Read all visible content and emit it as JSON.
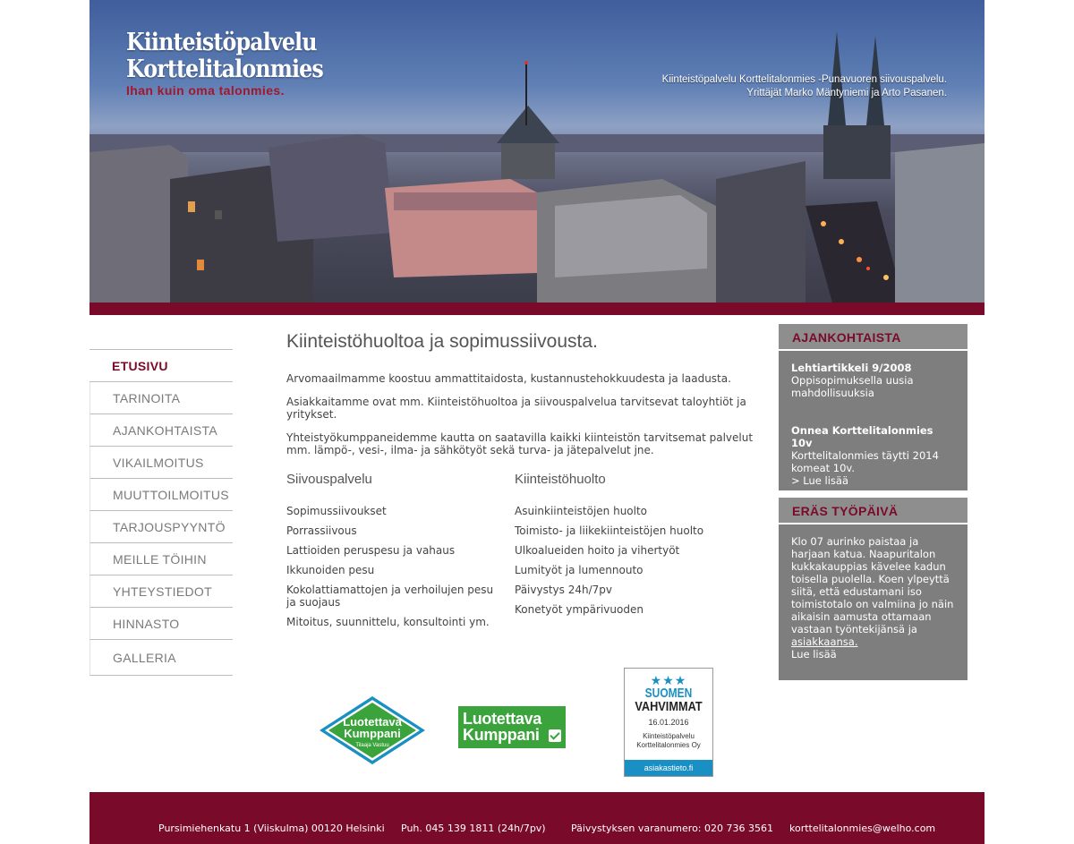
{
  "brand": {
    "line1": "Kiinteistöpalvelu",
    "line2": "Korttelitalonmies",
    "tagline": "Ihan kuin oma talonmies."
  },
  "header_info": {
    "line1": "Kiinteistöpalvelu Korttelitalonmies -Punavuoren siivouspalvelu.",
    "line2": "Yrittäjät Marko Mäntyniemi ja Arto Pasanen."
  },
  "nav": {
    "items": [
      {
        "label": "ETUSIVU",
        "active": true
      },
      {
        "label": "TARINOITA"
      },
      {
        "label": "AJANKOHTAISTA"
      },
      {
        "label": "VIKAILMOITUS"
      },
      {
        "label": "MUUTTOILMOITUS"
      },
      {
        "label": "TARJOUSPYYNTÖ"
      },
      {
        "label": "MEILLE TÖIHIN"
      },
      {
        "label": "YHTEYSTIEDOT"
      },
      {
        "label": "HINNASTO"
      },
      {
        "label": "GALLERIA"
      }
    ]
  },
  "main": {
    "title": "Kiinteistöhuoltoa ja sopimussiivousta.",
    "paragraphs": [
      "Arvomaailmamme koostuu ammattitaidosta, kustannustehokkuudesta ja laadusta.",
      "Asiakkaitamme ovat mm. Kiinteistöhuoltoa ja siivouspalvelua tarvitsevat taloyhtiöt ja yritykset.",
      "Yhteistyökumppaneidemme kautta on saatavilla kaikki kiinteistön tarvitsemat palvelut mm. lämpö-, vesi-, ilma- ja sähkötyöt sekä turva- ja jätepalvelut jne."
    ],
    "col1": {
      "heading": "Siivouspalvelu",
      "items": [
        "Sopimussiivoukset",
        "Porrassiivous",
        "Lattioiden peruspesu ja vahaus",
        "Ikkunoiden pesu",
        "Kokolattiamattojen ja verhoilujen pesu ja suojaus",
        "Mitoitus, suunnittelu, konsultointi ym."
      ]
    },
    "col2": {
      "heading": "Kiinteistöhuolto",
      "items": [
        "Asuinkiinteistöjen huolto",
        "Toimisto- ja liikekiinteistöjen huolto",
        "Ulkoalueiden hoito ja vihertyöt",
        "Lumityöt ja lumennouto",
        "Päivystys 24h/7pv",
        "Konetyöt ympärivuoden"
      ]
    }
  },
  "logos": {
    "badge1": {
      "line1": "Luotettava",
      "line2": "Kumppani",
      "line3": "Tilaaja Vastuu"
    },
    "badge2": {
      "line1": "Luotettava",
      "line2": "Kumppani"
    },
    "badge3": {
      "stars": "★★★",
      "line1": "SUOMEN",
      "line2": "VAHVIMMAT",
      "date": "16.01.2016",
      "company": "Kiinteistöpalvelu Korttelitalonmies Oy",
      "footer": "asiakastieto.fi"
    }
  },
  "sidebar": {
    "box1": {
      "title": "AJANKOHTAISTA",
      "news": [
        {
          "title": "Lehtiartikkeli 9/2008",
          "text": "Oppisopimuksella uusia mahdollisuuksia"
        },
        {
          "title": "Onnea Korttelitalonmies 10v",
          "text": "Korttelitalonmies täytti 2014 komeat 10v.",
          "link": "> Lue lisää"
        }
      ]
    },
    "box2": {
      "title": "ERÄS TYÖPÄIVÄ",
      "text": "Klo 07 aurinko paistaa ja harjaan katua. Naapuritalon kukkakauppias kävelee kadun toisella puolella. Koen ylpeyttä siitä, että edustamani iso toimistotalo on valmiina jo näin aikaisin aamusta ottamaan vastaan työntekijänsä ja",
      "underlined": "asiakkaansa.",
      "link": "Lue lisää"
    }
  },
  "footer": {
    "address": "Pursimiehenkatu 1 (Viiskulma) 00120 Helsinki",
    "phone": "Puh. 045 139 1811 (24h/7pv)",
    "duty": "Päivystyksen varanumero: 020 736 3561",
    "email": "korttelitalonmies@welho.com"
  },
  "colors": {
    "brand_red": "#7a0a2a",
    "sidebar_gray": "#7e7e7e",
    "badge_green": "#3aa33b",
    "asiakastieto_blue": "#1a8fc4"
  }
}
